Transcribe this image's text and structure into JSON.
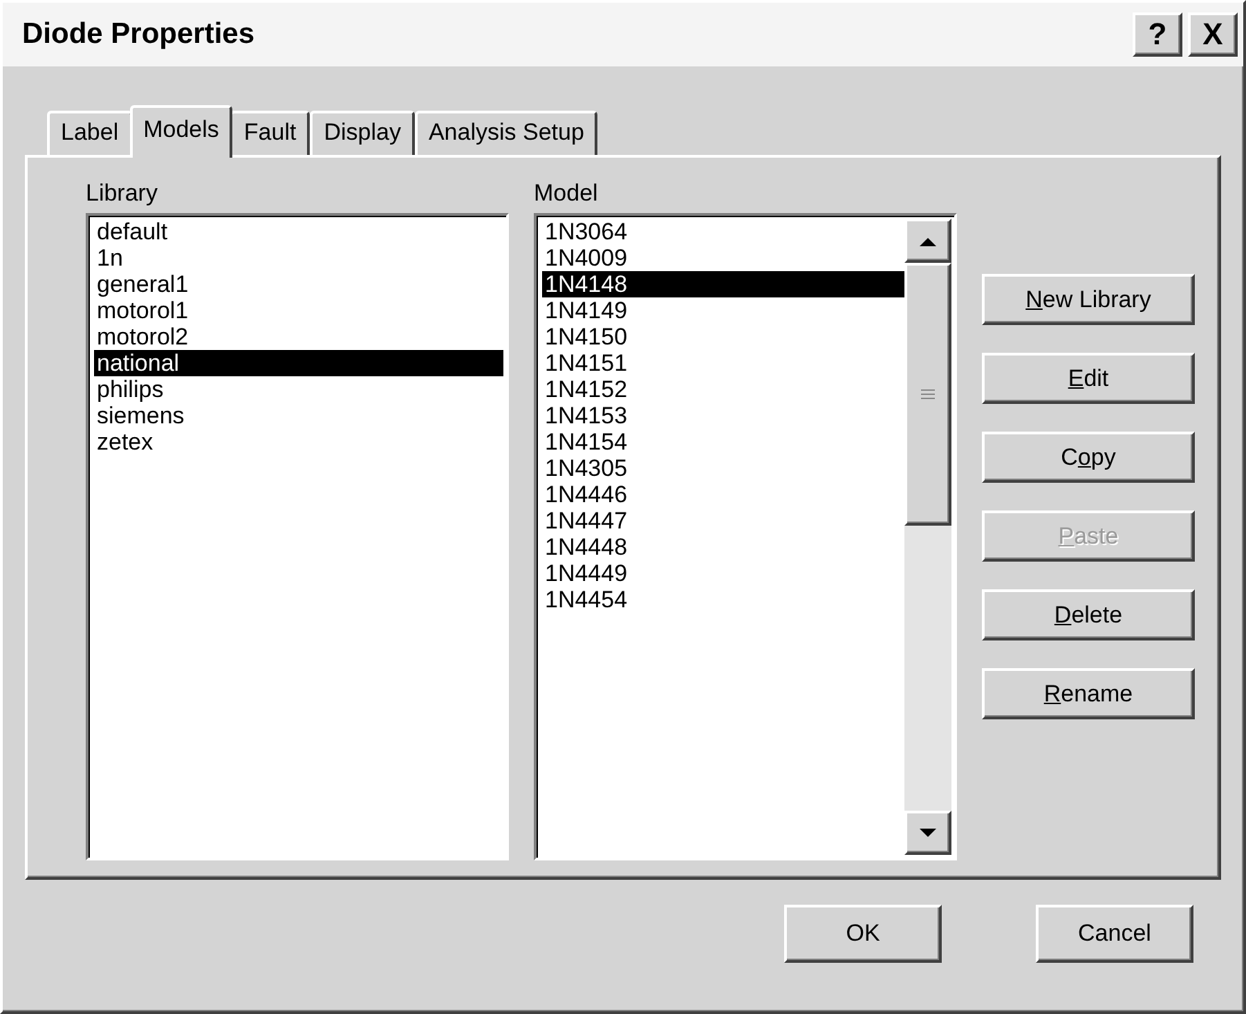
{
  "window": {
    "title": "Diode Properties",
    "title_buttons": [
      {
        "label": "?"
      },
      {
        "label": "X"
      }
    ]
  },
  "tabs": [
    {
      "label": "Label",
      "selected": false
    },
    {
      "label": "Models",
      "selected": true
    },
    {
      "label": "Fault",
      "selected": false
    },
    {
      "label": "Display",
      "selected": false
    },
    {
      "label": "Analysis Setup",
      "selected": false
    }
  ],
  "library": {
    "label": "Library",
    "items": [
      {
        "label": "default",
        "selected": false
      },
      {
        "label": "1n",
        "selected": false
      },
      {
        "label": "general1",
        "selected": false
      },
      {
        "label": "motorol1",
        "selected": false
      },
      {
        "label": "motorol2",
        "selected": false
      },
      {
        "label": "national",
        "selected": true
      },
      {
        "label": "philips",
        "selected": false
      },
      {
        "label": "siemens",
        "selected": false
      },
      {
        "label": "zetex",
        "selected": false
      }
    ]
  },
  "model": {
    "label": "Model",
    "items": [
      {
        "label": "1N3064",
        "selected": false
      },
      {
        "label": "1N4009",
        "selected": false
      },
      {
        "label": "1N4148",
        "selected": true
      },
      {
        "label": "1N4149",
        "selected": false
      },
      {
        "label": "1N4150",
        "selected": false
      },
      {
        "label": "1N4151",
        "selected": false
      },
      {
        "label": "1N4152",
        "selected": false
      },
      {
        "label": "1N4153",
        "selected": false
      },
      {
        "label": "1N4154",
        "selected": false
      },
      {
        "label": "1N4305",
        "selected": false
      },
      {
        "label": "1N4446",
        "selected": false
      },
      {
        "label": "1N4447",
        "selected": false
      },
      {
        "label": "1N4448",
        "selected": false
      },
      {
        "label": "1N4449",
        "selected": false
      },
      {
        "label": "1N4454",
        "selected": false
      }
    ]
  },
  "side_buttons": [
    {
      "parts": [
        {
          "text": "N",
          "underlined": true
        },
        {
          "text": "ew Library",
          "underlined": false
        }
      ],
      "disabled": false
    },
    {
      "parts": [
        {
          "text": "E",
          "underlined": true
        },
        {
          "text": "dit",
          "underlined": false
        }
      ],
      "disabled": false
    },
    {
      "parts": [
        {
          "text": "C",
          "underlined": false
        },
        {
          "text": "o",
          "underlined": true
        },
        {
          "text": "py",
          "underlined": false
        }
      ],
      "disabled": false
    },
    {
      "parts": [
        {
          "text": "P",
          "underlined": true
        },
        {
          "text": "aste",
          "underlined": false
        }
      ],
      "disabled": true
    },
    {
      "parts": [
        {
          "text": "D",
          "underlined": true
        },
        {
          "text": "elete",
          "underlined": false
        }
      ],
      "disabled": false
    },
    {
      "parts": [
        {
          "text": "R",
          "underlined": true
        },
        {
          "text": "ename",
          "underlined": false
        }
      ],
      "disabled": false
    }
  ],
  "footer_buttons": [
    {
      "label": "OK"
    },
    {
      "label": "Cancel"
    }
  ]
}
